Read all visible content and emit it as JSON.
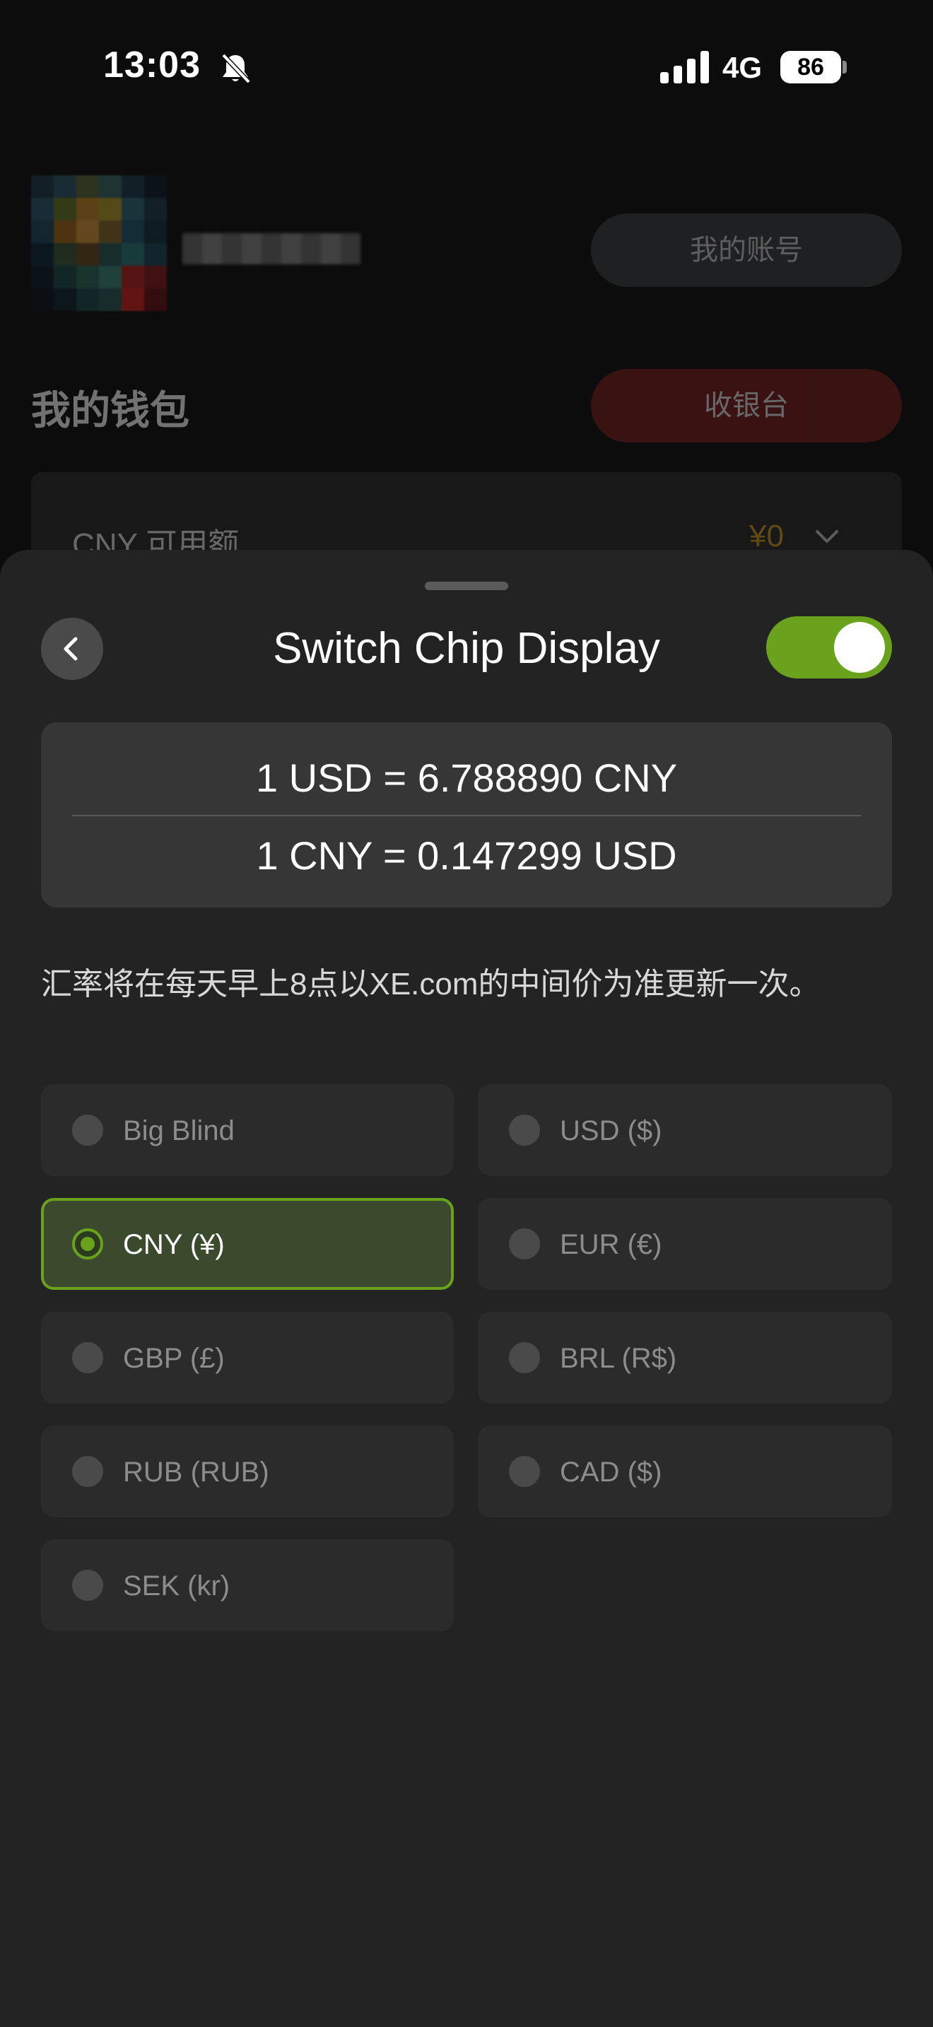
{
  "status_bar": {
    "time": "13:03",
    "network": "4G",
    "battery": "86",
    "icons": [
      "bell-muted-icon",
      "signal-icon",
      "battery-icon"
    ]
  },
  "background": {
    "my_account_label": "我的账号",
    "wallet_title": "我的钱包",
    "checkout_label": "收银台",
    "balance_label": "CNY 可用额",
    "balance_amount": "¥0"
  },
  "sheet": {
    "title": "Switch Chip Display",
    "toggle_on": true,
    "rates": {
      "usd_to_cny": "1 USD = 6.788890 CNY",
      "cny_to_usd": "1 CNY = 0.147299 USD"
    },
    "note": "汇率将在每天早上8点以XE.com的中间价为准更新一次。",
    "options": [
      {
        "label": "Big Blind",
        "selected": false
      },
      {
        "label": "USD ($)",
        "selected": false
      },
      {
        "label": "CNY (¥)",
        "selected": true
      },
      {
        "label": "EUR (€)",
        "selected": false
      },
      {
        "label": "GBP (£)",
        "selected": false
      },
      {
        "label": "BRL (R$)",
        "selected": false
      },
      {
        "label": "RUB (RUB)",
        "selected": false
      },
      {
        "label": "CAD ($)",
        "selected": false
      },
      {
        "label": "SEK (kr)",
        "selected": false
      }
    ]
  },
  "colors": {
    "accent_green": "#6aa21e",
    "sheet_bg": "#232323",
    "balance_gold": "#d4a020",
    "checkout_red": "#7a1c1c"
  }
}
